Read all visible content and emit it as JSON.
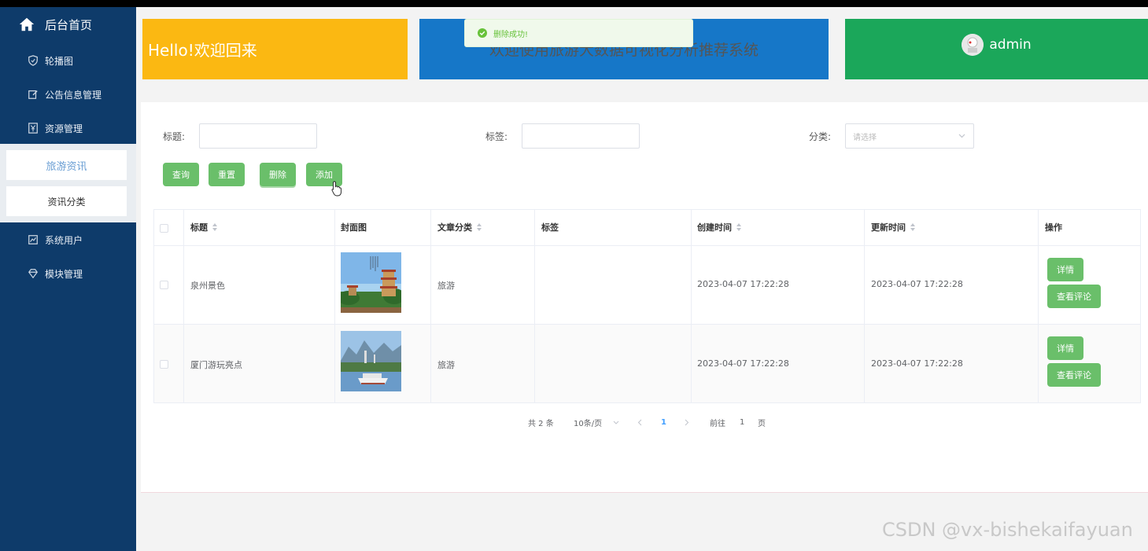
{
  "sidebar": {
    "home_label": "后台首页",
    "items": [
      {
        "label": "轮播图",
        "icon": "shield-icon"
      },
      {
        "label": "公告信息管理",
        "icon": "edit-icon"
      },
      {
        "label": "资源管理",
        "icon": "yen-icon"
      },
      {
        "label": "系统用户",
        "icon": "chart-icon"
      },
      {
        "label": "模块管理",
        "icon": "diamond-icon"
      }
    ],
    "subitems": [
      {
        "label": "旅游资讯",
        "active": true
      },
      {
        "label": "资讯分类",
        "active": false
      }
    ]
  },
  "header": {
    "welcome": "Hello!欢迎回来",
    "system_title": "欢迎使用旅游大数据可视化分析推荐系统",
    "username": "admin"
  },
  "toast": {
    "message": "删除成功!"
  },
  "filters": {
    "title_label": "标题:",
    "tag_label": "标签:",
    "category_label": "分类:",
    "category_placeholder": "请选择"
  },
  "actions": {
    "query": "查询",
    "reset": "重置",
    "delete": "删除",
    "add": "添加"
  },
  "table": {
    "headers": [
      "标题",
      "封面图",
      "文章分类",
      "标签",
      "创建时间",
      "更新时间",
      "操作"
    ],
    "rows": [
      {
        "title": "泉州景色",
        "category": "旅游",
        "tag": "",
        "created": "2023-04-07 17:22:28",
        "updated": "2023-04-07 17:22:28"
      },
      {
        "title": "厦门游玩亮点",
        "category": "旅游",
        "tag": "",
        "created": "2023-04-07 17:22:28",
        "updated": "2023-04-07 17:22:28"
      }
    ],
    "detail_label": "详情",
    "comment_label": "查看评论"
  },
  "pager": {
    "total": "共 2 条",
    "page_size": "10条/页",
    "current": "1",
    "goto_label": "前往",
    "goto_value": "1",
    "page_suffix": "页"
  },
  "watermark": "CSDN @vx-bishekaifayuan",
  "colors": {
    "sidebar": "#0e3b6a",
    "yellow": "#fbb812",
    "blue": "#1677c8",
    "green": "#1ba75a",
    "button": "#6abf6a"
  }
}
